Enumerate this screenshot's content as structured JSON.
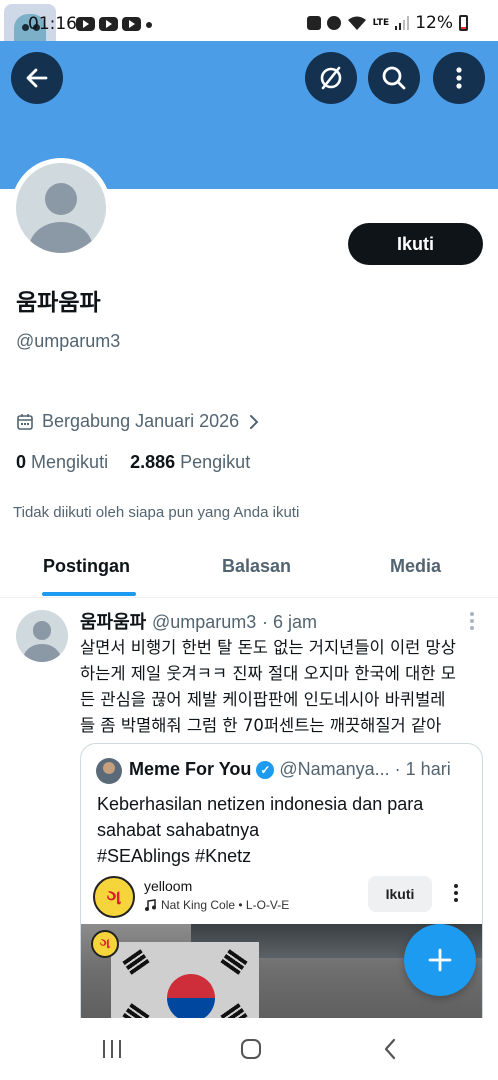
{
  "status_bar": {
    "time": "01:16",
    "network": "LTE",
    "battery": "12%"
  },
  "profile": {
    "display_name": "움파움파",
    "handle": "@umparum3",
    "joined": "Bergabung Januari 2026",
    "following_count": "0",
    "following_label": "Mengikuti",
    "followers_count": "2.886",
    "followers_label": "Pengikut",
    "not_followed_note": "Tidak diikuti oleh siapa pun yang Anda ikuti",
    "follow_button": "Ikuti"
  },
  "tabs": [
    {
      "label": "Postingan",
      "active": true
    },
    {
      "label": "Balasan",
      "active": false
    },
    {
      "label": "Media",
      "active": false
    }
  ],
  "post": {
    "author_name": "움파움파",
    "author_handle": "@umparum3",
    "time": "· 6 jam",
    "text_lines": [
      "살면서 비행기 한번 탈 돈도 없는 거지년들이 이런 망상",
      "하는게 제일 웃겨ㅋㅋ 진짜 절대 오지마 한국에 대한 모",
      "든 관심을 끊어 제발 케이팝판에 인도네시아 바퀴벌레",
      "들 좀 박멸해줘 그럼 한 70퍼센트는 깨끗해질거 같아"
    ],
    "quote": {
      "author_name": "Meme For You",
      "author_handle": "@Namanya...",
      "time": "· 1 hari",
      "text_lines": [
        "Keberhasilan netizen indonesia dan para",
        "sahabat sahabatnya",
        "#SEAblings #Knetz"
      ],
      "media": {
        "logo_glyph": "ગ",
        "account": "yelloom",
        "music": "Nat King Cole • L-O-V-E",
        "follow_label": "Ikuti"
      }
    }
  },
  "icons": {
    "back": "arrow-left-icon",
    "no_notification": "slashed-circle-icon",
    "search": "search-icon",
    "more": "more-vertical-icon",
    "calendar": "calendar-icon",
    "compose": "plus-icon"
  },
  "colors": {
    "banner": "#4c9de8",
    "accent": "#1d9bf0",
    "button_dark": "#0f1419"
  }
}
